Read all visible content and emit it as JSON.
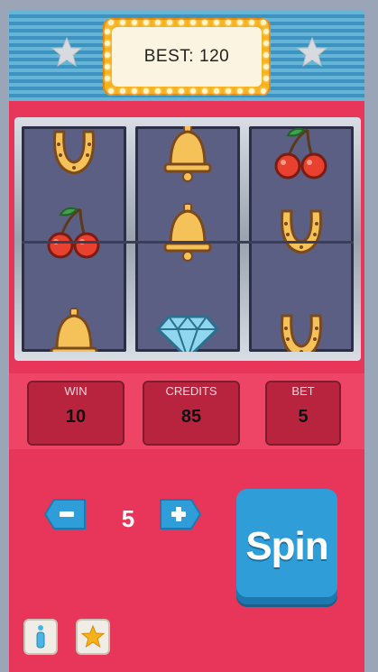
{
  "marquee": {
    "label": "BEST:",
    "value": "120"
  },
  "reels": [
    [
      "horseshoe-icon",
      "cherries-icon",
      "bell-icon"
    ],
    [
      "bell-icon",
      "bell-icon",
      "diamond-icon"
    ],
    [
      "cherries-icon",
      "horseshoe-icon",
      "horseshoe-icon"
    ]
  ],
  "stats": {
    "win": {
      "label": "WIN",
      "value": "10"
    },
    "credits": {
      "label": "CREDITS",
      "value": "85"
    },
    "bet": {
      "label": "BET",
      "value": "5"
    }
  },
  "bet_stepper": {
    "minus_label": "−",
    "value": "5",
    "plus_label": "+"
  },
  "spin_button": {
    "label": "Spin"
  },
  "footer_buttons": {
    "info_icon": "info-icon",
    "favorite_icon": "star-icon"
  },
  "colors": {
    "cabinet": "#e8355a",
    "reel_bg": "#5b5f83",
    "accent_blue": "#2f9ed8",
    "marquee_gold": "#f6b21c"
  }
}
